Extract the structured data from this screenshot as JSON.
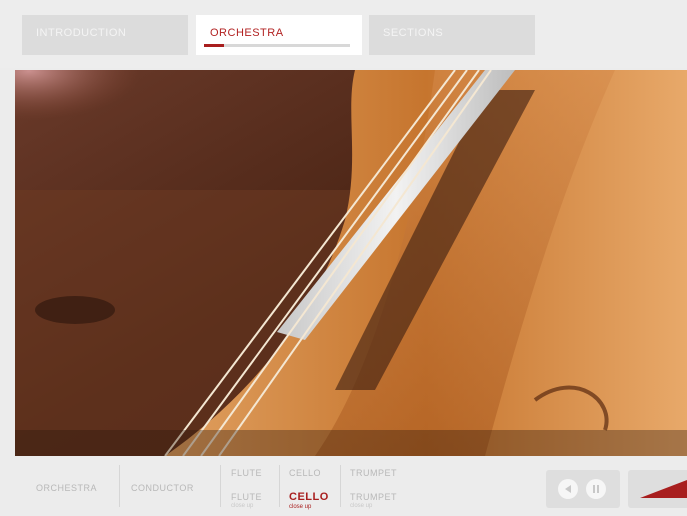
{
  "tabs": [
    {
      "label": "INTRODUCTION",
      "active": false
    },
    {
      "label": "ORCHESTRA",
      "active": true,
      "progress": 0.14
    },
    {
      "label": "SECTIONS",
      "active": false
    }
  ],
  "hero": {
    "subject": "cello close-up"
  },
  "bottom_nav": {
    "orchestra": "ORCHESTRA",
    "conductor": "CONDUCTOR",
    "flute_top": "FLUTE",
    "cello_top": "CELLO",
    "trumpet_top": "TRUMPET",
    "flute": {
      "label": "FLUTE",
      "sub": "close up"
    },
    "cello": {
      "label": "CELLO",
      "sub": "close up"
    },
    "trumpet": {
      "label": "TRUMPET",
      "sub": "close up"
    }
  },
  "controls": {
    "rewind_icon": "rewind-icon",
    "pause_icon": "pause-icon",
    "next_icon": "next-arrow-icon"
  },
  "colors": {
    "accent": "#a81e1e",
    "bar": "#ececec",
    "tab": "#dcdcdc"
  }
}
